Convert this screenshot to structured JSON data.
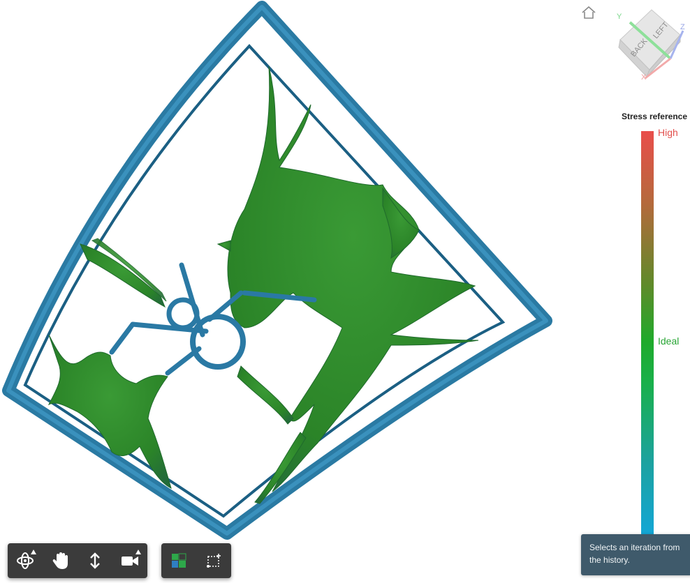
{
  "legend": {
    "title": "Stress reference",
    "high_label": "High",
    "ideal_label": "Ideal",
    "colors": {
      "high": "#e94e4b",
      "ideal": "#19b04a",
      "low": "#13a6d6"
    }
  },
  "view_cube": {
    "face_back": "BACK",
    "face_left": "LEFT",
    "axis_x": "X",
    "axis_y": "Y",
    "axis_z": "Z"
  },
  "tooltip": {
    "text": "Selects an iteration from the history."
  },
  "toolbar": {
    "nav_tools": [
      {
        "name": "orbit-button",
        "icon": "orbit-icon",
        "has_flyout": true
      },
      {
        "name": "pan-button",
        "icon": "hand-icon",
        "has_flyout": false
      },
      {
        "name": "zoom-button",
        "icon": "vertical-arrows-icon",
        "has_flyout": false
      },
      {
        "name": "camera-button",
        "icon": "camera-icon",
        "has_flyout": true
      }
    ],
    "view_tools": [
      {
        "name": "display-mode-button",
        "icon": "grid-color-icon"
      },
      {
        "name": "fit-section-button",
        "icon": "section-box-icon"
      }
    ]
  },
  "model": {
    "frame_color": "#2f7ea3",
    "body_color": "#2e8f2c"
  }
}
